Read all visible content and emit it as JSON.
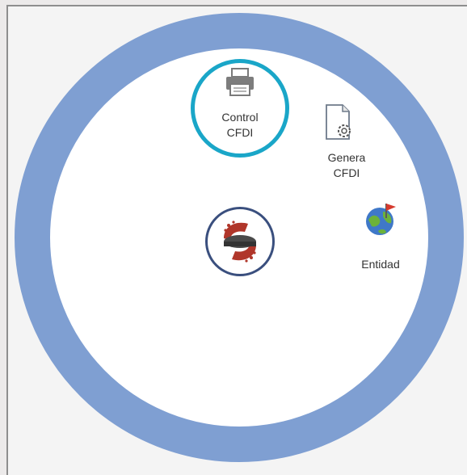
{
  "apps": {
    "control_cfdi": {
      "label_line1": "Control",
      "label_line2": "CFDI",
      "icon": "printer-icon"
    },
    "genera_cfdi": {
      "label_line1": "Genera",
      "label_line2": "CFDI",
      "icon": "document-gear-icon"
    },
    "entidad": {
      "label": "Entidad",
      "icon": "globe-flag-icon"
    },
    "main_logo": {
      "icon": "app-logo-icon"
    }
  },
  "colors": {
    "ring": "#7f9fd2",
    "highlight": "#1aa6c8",
    "logo_border": "#3a4f7e",
    "background": "#eceaea"
  }
}
